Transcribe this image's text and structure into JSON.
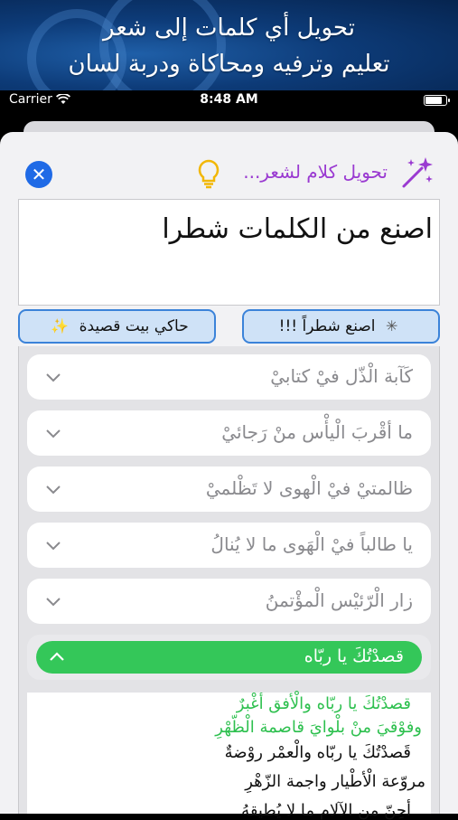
{
  "banner": {
    "line1": "تحويل أي كلمات إلى شعر",
    "line2": "تعليم وترفيه ومحاكاة ودربة لسان"
  },
  "status_bar": {
    "carrier": "Carrier",
    "time": "8:48 AM",
    "battery_level": 0.9
  },
  "header": {
    "title": "تحويل كلام لشعر...",
    "close_icon": "close-icon",
    "hint_icon": "lightbulb-icon",
    "magic_icon": "magic-wand-icon"
  },
  "input": {
    "value": "اصنع من الكلمات شطرا"
  },
  "buttons": {
    "make_verse": "اصنع شطراً !!!",
    "imitate_poem": "حاكي بيت قصيدة"
  },
  "results": [
    {
      "label": "كَآبة الْذّل فيْ كتابيْ",
      "expanded": false
    },
    {
      "label": "ما أقْربَ الْيأْس منْ رَجائيْ",
      "expanded": false
    },
    {
      "label": "ظالمتيْ فيْ الْهوى لا تَظْلميْ",
      "expanded": false
    },
    {
      "label": "يا طالباً فيْ الْهَوى ما لا يُنالُ",
      "expanded": false
    },
    {
      "label": "زار الْرّئيْس الْمؤْتمنُ",
      "expanded": false
    },
    {
      "label": "قصدْتُكَ يا ربّاه",
      "expanded": true
    }
  ],
  "poem": {
    "verses": [
      {
        "text": "قصدْتُكَ يا ربّاه والْأفق أغْبرٌ",
        "color": "green"
      },
      {
        "text": "وفوْقيَ منْ بلْوايَ قاصمة الْظّهْرِ",
        "color": "green"
      },
      {
        "text": "قَصدْتُكَ يا ربّاه والْعمْر روْضةٌ",
        "color": "black"
      },
      {
        "text": "مروّعة الْأطْيار واجمة الزّهْرِ",
        "color": "black"
      },
      {
        "text": "أحِنّ من الآلامِ ما لا يُطيقهُ",
        "color": "black"
      }
    ]
  }
}
